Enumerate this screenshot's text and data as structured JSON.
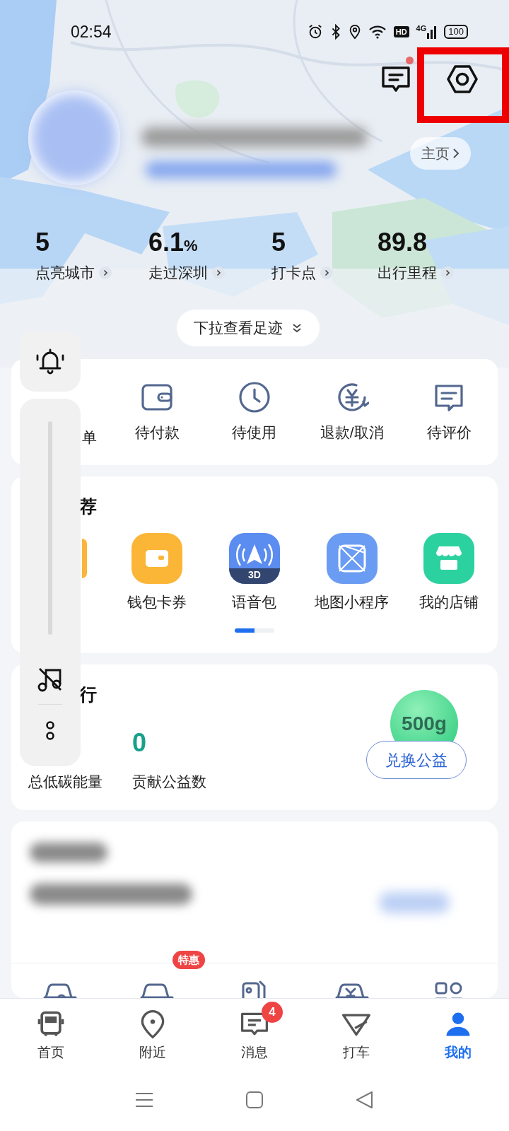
{
  "status_bar": {
    "time": "02:54",
    "hd": "HD",
    "network": "4G",
    "battery": "100"
  },
  "header": {
    "message_unread": true,
    "settings_highlighted": true,
    "home_button": "主页"
  },
  "stats": [
    {
      "value": "5",
      "label": "点亮城市"
    },
    {
      "value": "6.1",
      "unit": "%",
      "label": "走过深圳"
    },
    {
      "value": "5",
      "label": "打卡点"
    },
    {
      "value": "89.8",
      "label": "出行里程"
    }
  ],
  "footprint_button": "下拉查看足迹",
  "orders": [
    {
      "kind": "partial",
      "label": "单"
    },
    {
      "kind": "wallet",
      "label": "待付款"
    },
    {
      "kind": "clock",
      "label": "待使用"
    },
    {
      "kind": "refund",
      "label": "退款/取消"
    },
    {
      "kind": "comment",
      "label": "待评价"
    }
  ],
  "recommend": {
    "title": "荐",
    "items": [
      {
        "kind": "partial"
      },
      {
        "kind": "wallet",
        "label": "钱包卡券"
      },
      {
        "kind": "voice",
        "label": "语音包",
        "tag": "3D"
      },
      {
        "kind": "miniapp",
        "label": "地图小程序"
      },
      {
        "kind": "shop",
        "label": "我的店铺"
      }
    ],
    "pages": [
      {
        "selected": true
      },
      {
        "selected": false
      }
    ]
  },
  "green": {
    "title": "行",
    "stats": [
      {
        "label": "总低碳能量"
      },
      {
        "value": "0",
        "label": "贡献公益数"
      }
    ],
    "badge": "500g",
    "button": "兑换公益"
  },
  "services": [
    {
      "kind": "car-key"
    },
    {
      "kind": "car-cart",
      "tag": "特惠"
    },
    {
      "kind": "fuel"
    },
    {
      "kind": "car-yuan"
    },
    {
      "kind": "grid"
    }
  ],
  "tab_bar": [
    {
      "kind": "bus",
      "label": "首页",
      "selected": false
    },
    {
      "kind": "pin",
      "label": "附近",
      "selected": false
    },
    {
      "kind": "message",
      "label": "消息",
      "selected": false,
      "badge": "4"
    },
    {
      "kind": "taxi",
      "label": "打车",
      "selected": false
    },
    {
      "kind": "person",
      "label": "我的",
      "selected": true
    }
  ]
}
